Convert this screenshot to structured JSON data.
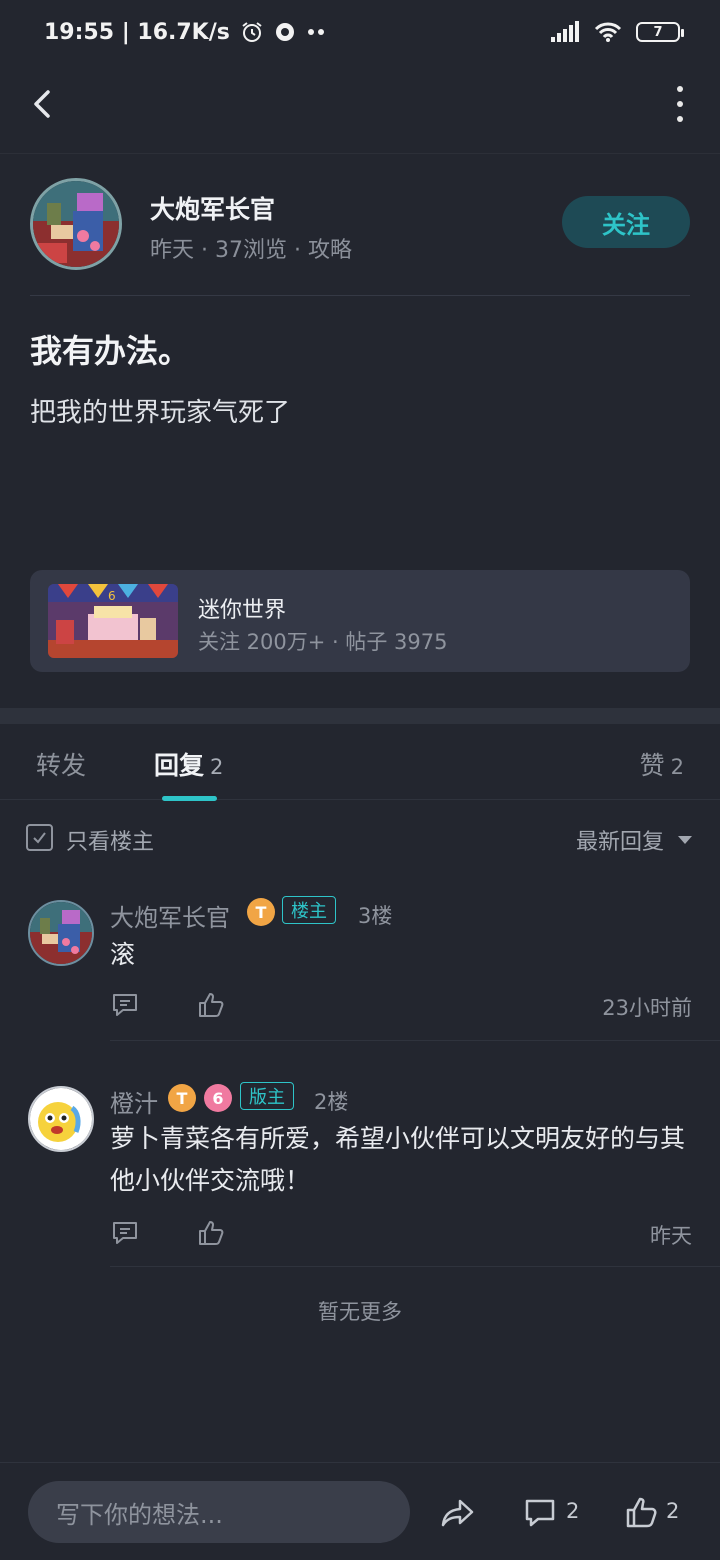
{
  "status_bar": {
    "time_speed": "19:55 | 16.7K/s",
    "battery": "7"
  },
  "post": {
    "author": "大炮军长官",
    "meta": "昨天 · 37浏览 · 攻略",
    "follow_label": "关注",
    "title": "我有办法。",
    "body": "把我的世界玩家气死了"
  },
  "game": {
    "name": "迷你世界",
    "stats": "关注 200万+ · 帖子 3975"
  },
  "tabs": [
    {
      "label": "转发",
      "count": ""
    },
    {
      "label": "回复",
      "count": "2"
    },
    {
      "label": "赞",
      "count": "2"
    }
  ],
  "filter": {
    "only_op": "只看楼主",
    "sort": "最新回复"
  },
  "replies": [
    {
      "name": "大炮军长官",
      "level": "T",
      "role": "楼主",
      "floor": "3楼",
      "text": "滚",
      "time": "23小时前"
    },
    {
      "name": "橙汁",
      "level": "T",
      "extra_badge": "6",
      "role": "版主",
      "floor": "2楼",
      "text": "萝卜青菜各有所爱，希望小伙伴可以文明友好的与其他小伙伴交流哦！",
      "time": "昨天"
    }
  ],
  "no_more": "暂无更多",
  "bottom": {
    "placeholder": "写下你的想法...",
    "comment_count": "2",
    "like_count": "2"
  },
  "colors": {
    "background": "#23262f",
    "accent": "#2ec4c8",
    "card": "#343846"
  }
}
